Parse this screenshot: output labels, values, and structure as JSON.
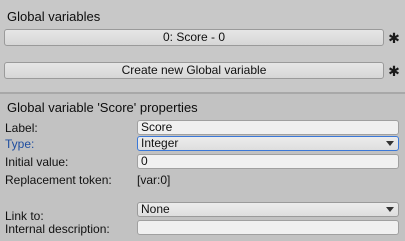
{
  "global_variables": {
    "title": "Global variables",
    "items": [
      {
        "label": "0: Score - 0"
      }
    ],
    "create_button_label": "Create new Global variable",
    "gear_icon": "gear-icon"
  },
  "properties": {
    "title": "Global variable 'Score' properties",
    "label_caption": "Label:",
    "label_value": "Score",
    "type_caption": "Type:",
    "type_value": "Integer",
    "initial_value_caption": "Initial value:",
    "initial_value": "0",
    "replacement_token_caption": "Replacement token:",
    "replacement_token_value": "[var:0]",
    "link_to_caption": "Link to:",
    "link_to_value": "None",
    "internal_description_caption": "Internal description:",
    "internal_description_value": ""
  }
}
